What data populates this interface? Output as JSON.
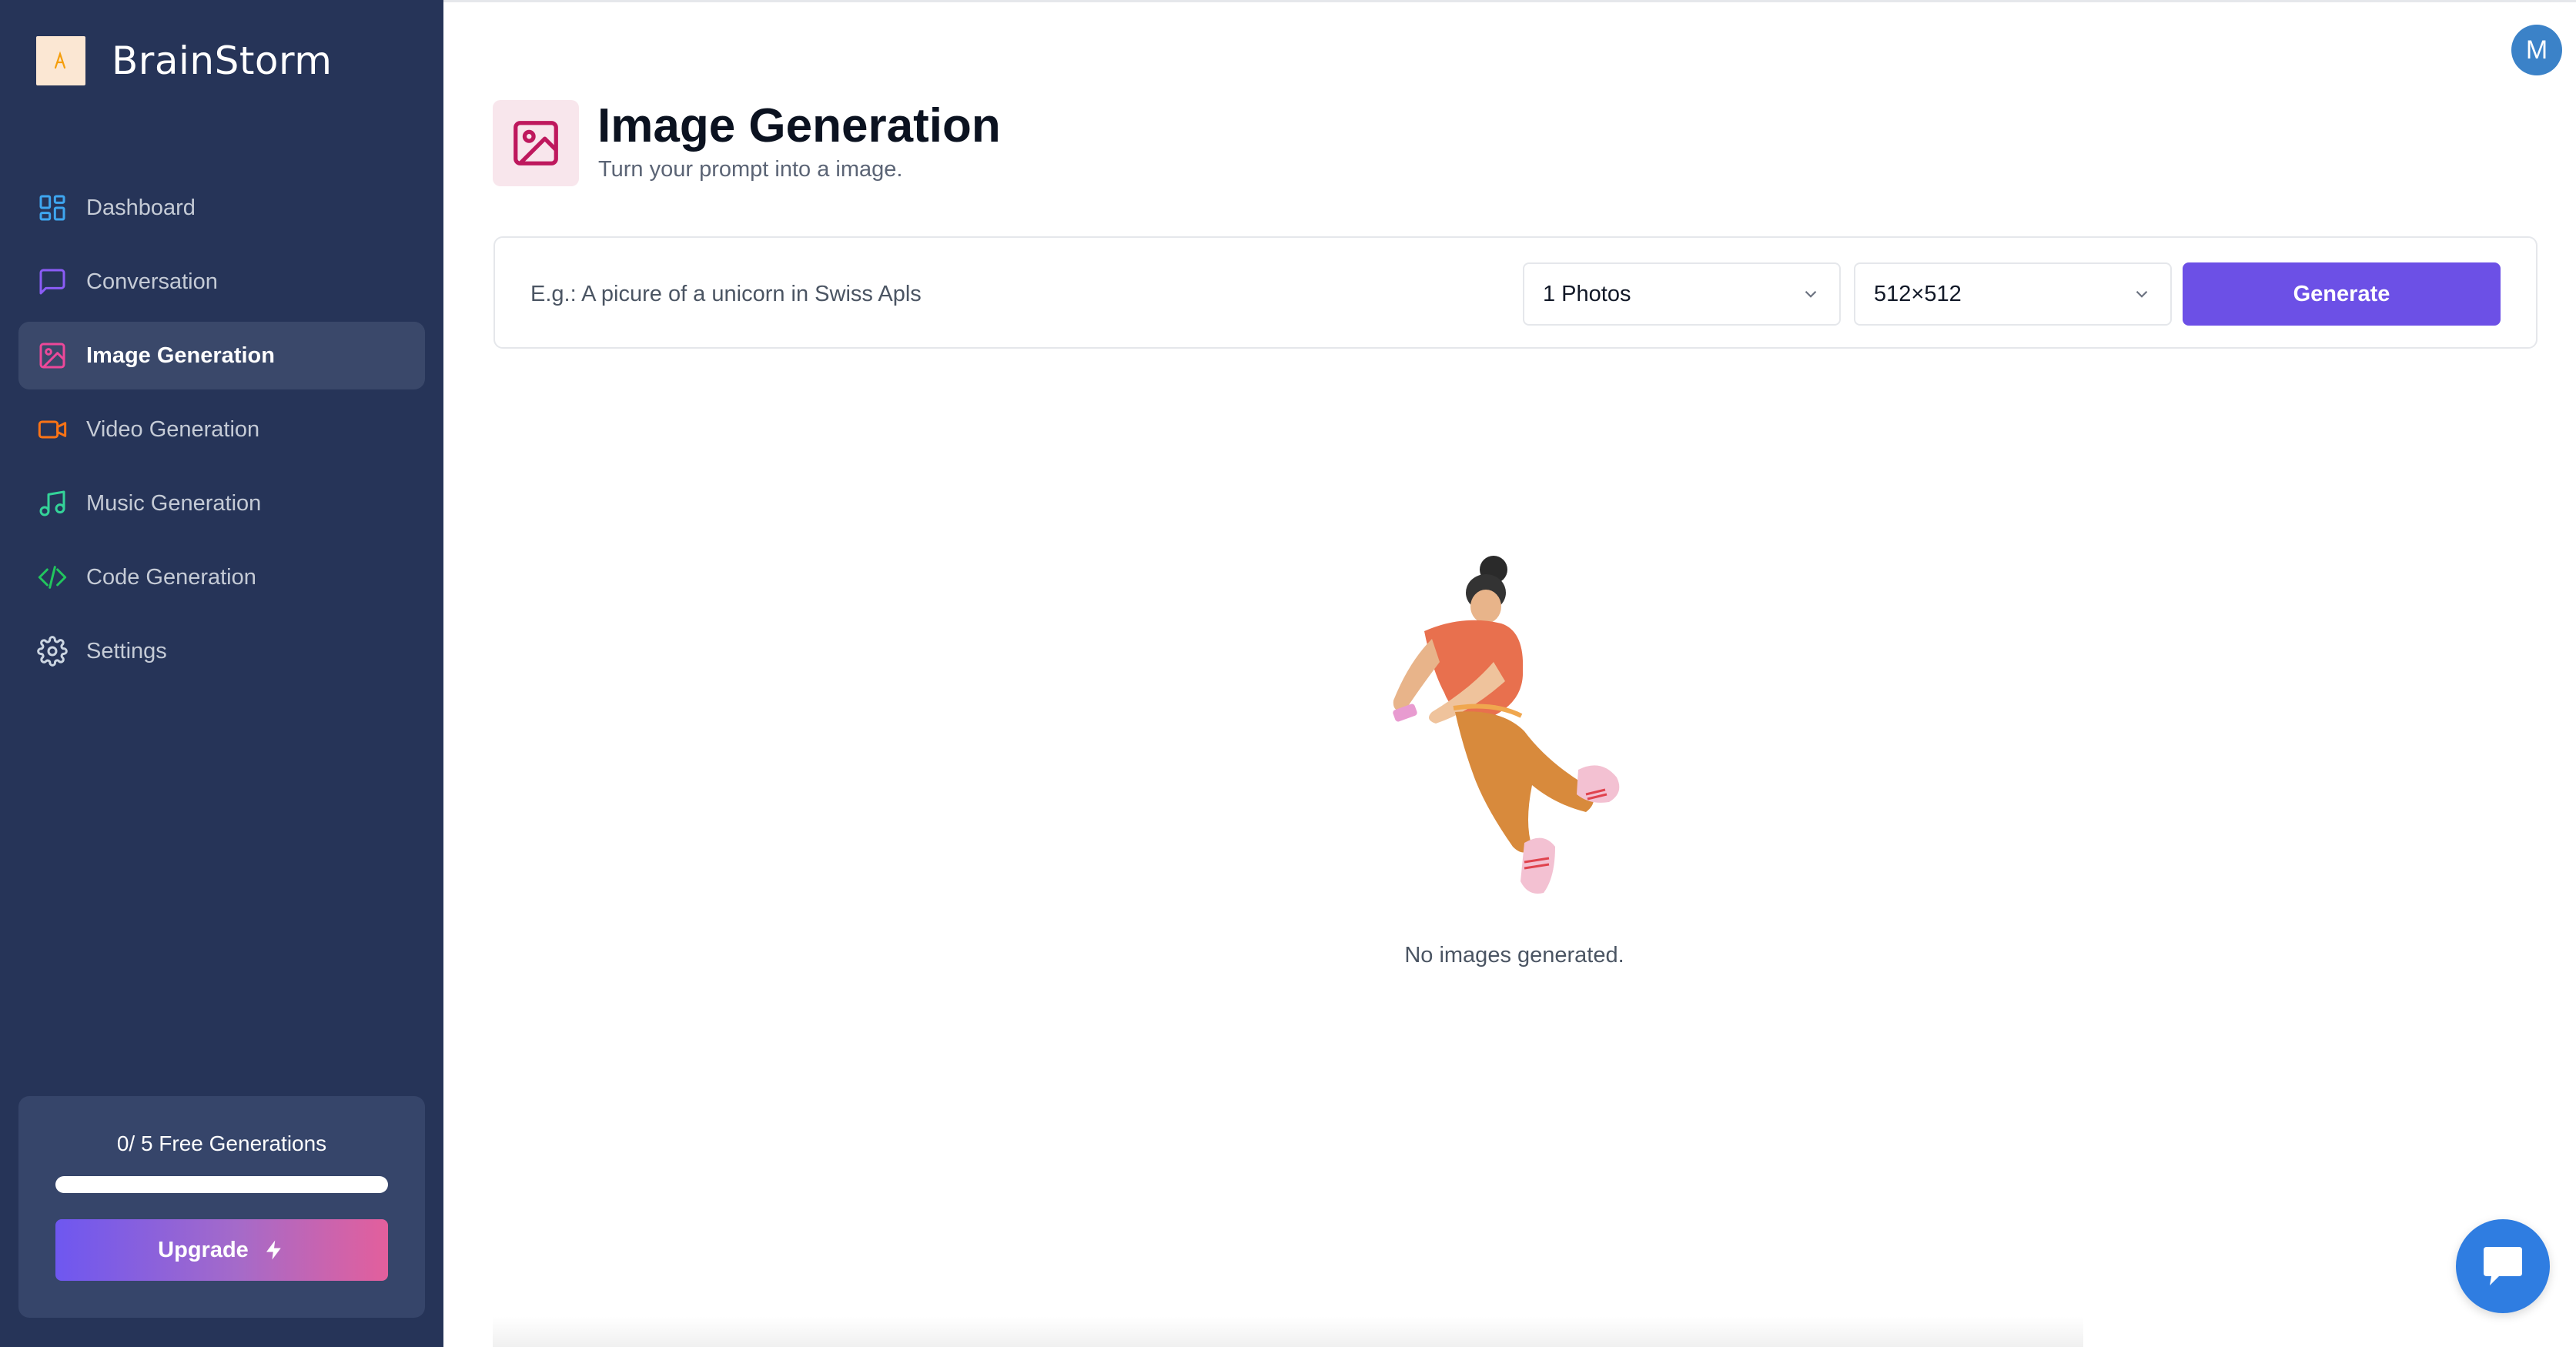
{
  "brand": {
    "name": "BrainStorm",
    "logo_text": "A"
  },
  "sidebar": {
    "items": [
      {
        "label": "Dashboard",
        "icon": "dashboard-grid-icon",
        "color": "#3ea6f0",
        "active": false
      },
      {
        "label": "Conversation",
        "icon": "message-square-icon",
        "color": "#8b5cf6",
        "active": false
      },
      {
        "label": "Image Generation",
        "icon": "image-icon",
        "color": "#ec4899",
        "active": true
      },
      {
        "label": "Video Generation",
        "icon": "video-camera-icon",
        "color": "#f97316",
        "active": false
      },
      {
        "label": "Music Generation",
        "icon": "music-note-icon",
        "color": "#34d399",
        "active": false
      },
      {
        "label": "Code Generation",
        "icon": "code-icon",
        "color": "#22c55e",
        "active": false
      },
      {
        "label": "Settings",
        "icon": "gear-icon",
        "color": "#cbd5e1",
        "active": false
      }
    ],
    "free_generations": {
      "label": "0/ 5 Free Generations",
      "used": 0,
      "total": 5,
      "upgrade_label": "Upgrade",
      "upgrade_icon": "lightning-icon"
    }
  },
  "header": {
    "avatar_letter": "M",
    "title": "Image Generation",
    "subtitle": "Turn your prompt into a image.",
    "icon": "image-icon",
    "icon_color": "#be185d"
  },
  "form": {
    "prompt_placeholder": "E.g.: A picure of a unicorn in Swiss Apls",
    "prompt_value": "",
    "amount_value": "1 Photos",
    "resolution_value": "512×512",
    "generate_label": "Generate"
  },
  "empty_state": {
    "message": "No images generated.",
    "illustration": "floating-person-illustration"
  },
  "chat_widget": {
    "icon": "chat-bubble-icon"
  },
  "colors": {
    "sidebar_bg": "#263458",
    "accent": "#6c50e6",
    "chat_bg": "#2f7de1"
  }
}
